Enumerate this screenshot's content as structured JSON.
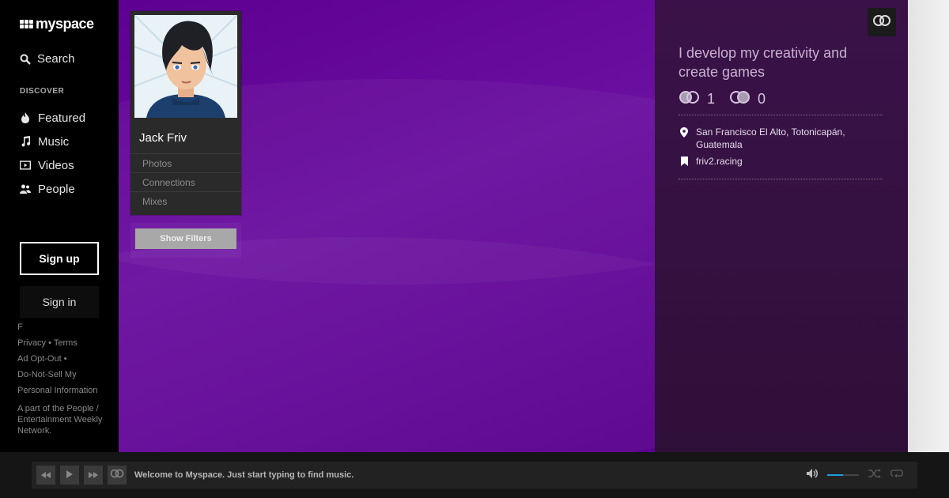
{
  "brand": {
    "name": "myspace"
  },
  "nav": {
    "search_label": "Search",
    "discover_heading": "DISCOVER",
    "items": [
      {
        "label": "Featured",
        "icon": "flame-icon"
      },
      {
        "label": "Music",
        "icon": "music-note-icon"
      },
      {
        "label": "Videos",
        "icon": "video-icon"
      },
      {
        "label": "People",
        "icon": "people-icon"
      }
    ],
    "signup_label": "Sign up",
    "signin_label": "Sign in"
  },
  "footer": {
    "partial_line": "F",
    "privacy": "Privacy",
    "terms": "Terms",
    "ad_opt_out": "Ad Opt-Out",
    "do_not_sell": "Do-Not-Sell My",
    "personal_info": "Personal Information",
    "network": "A part of the People / Entertainment Weekly Network."
  },
  "profile": {
    "name": "Jack Friv",
    "links": [
      "Photos",
      "Connections",
      "Mixes"
    ],
    "show_filters_label": "Show Filters"
  },
  "info": {
    "bio": "I develop my creativity and create games",
    "connections_in": "1",
    "connections_out": "0",
    "location": "San Francisco El Alto, Totonicapán, Guatemala",
    "website": "friv2.racing"
  },
  "player": {
    "message": "Welcome to Myspace. Just start typing to find music.",
    "volume_fraction": 0.5
  },
  "colors": {
    "main_purple": "#5e0092",
    "info_panel": "#3a1249",
    "volume_accent": "#1a9fe0"
  }
}
